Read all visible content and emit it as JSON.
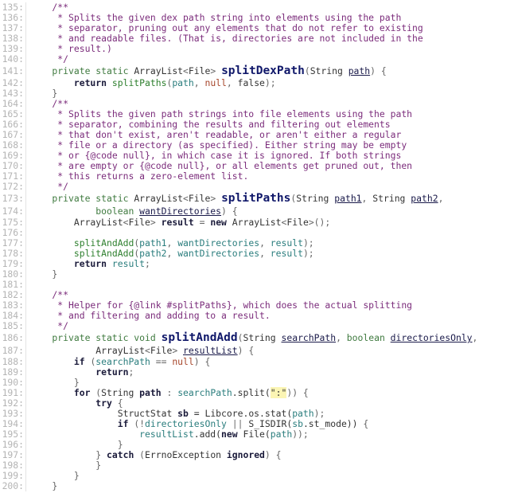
{
  "editor": {
    "colors": {
      "comment": "#7b2c7b",
      "keyword": "#3f7a3f",
      "method_decl": "#10186a",
      "call": "#2d7f2d",
      "variable": "#2a7d7d",
      "null": "#a6452a",
      "string_bg": "#fbf5b4"
    },
    "lines": [
      {
        "num": "135:",
        "tokens": [
          [
            "c",
            "    /**"
          ]
        ]
      },
      {
        "num": "136:",
        "tokens": [
          [
            "c",
            "     * Splits the given dex path string into elements using the path"
          ]
        ]
      },
      {
        "num": "137:",
        "tokens": [
          [
            "c",
            "     * separator, pruning out any elements that do not refer to existing"
          ]
        ]
      },
      {
        "num": "138:",
        "tokens": [
          [
            "c",
            "     * and readable files. (That is, directories are not included in the"
          ]
        ]
      },
      {
        "num": "139:",
        "tokens": [
          [
            "c",
            "     * result.)"
          ]
        ]
      },
      {
        "num": "140:",
        "tokens": [
          [
            "c",
            "     */"
          ]
        ]
      },
      {
        "num": "141:",
        "kind": "sig",
        "tokens": [
          [
            "k",
            "    private static "
          ],
          [
            "t",
            "ArrayList"
          ],
          [
            "p",
            "<"
          ],
          [
            "t",
            "File"
          ],
          [
            "p",
            "> "
          ],
          [
            "m",
            "splitDexPath"
          ],
          [
            "p",
            "("
          ],
          [
            "t",
            "String "
          ],
          [
            "u",
            "path"
          ],
          [
            "p",
            ") {"
          ]
        ]
      },
      {
        "num": "142:",
        "tokens": [
          [
            "kb",
            "        return "
          ],
          [
            "f",
            "splitPaths"
          ],
          [
            "p",
            "("
          ],
          [
            "v",
            "path"
          ],
          [
            "p",
            ", "
          ],
          [
            "n",
            "null"
          ],
          [
            "p",
            ", "
          ],
          [
            "t",
            "false"
          ],
          [
            "p",
            ");"
          ]
        ]
      },
      {
        "num": "143:",
        "tokens": [
          [
            "p",
            "    }"
          ]
        ]
      },
      {
        "num": "164:",
        "tokens": [
          [
            "c",
            "    /**"
          ]
        ]
      },
      {
        "num": "165:",
        "tokens": [
          [
            "c",
            "     * Splits the given path strings into file elements using the path"
          ]
        ]
      },
      {
        "num": "166:",
        "tokens": [
          [
            "c",
            "     * separator, combining the results and filtering out elements"
          ]
        ]
      },
      {
        "num": "167:",
        "tokens": [
          [
            "c",
            "     * that don't exist, aren't readable, or aren't either a regular"
          ]
        ]
      },
      {
        "num": "168:",
        "tokens": [
          [
            "c",
            "     * file or a directory (as specified). Either string may be empty"
          ]
        ]
      },
      {
        "num": "169:",
        "tokens": [
          [
            "c",
            "     * or {@code null}, in which case it is ignored. If both strings"
          ]
        ]
      },
      {
        "num": "170:",
        "tokens": [
          [
            "c",
            "     * are empty or {@code null}, or all elements get pruned out, then"
          ]
        ]
      },
      {
        "num": "171:",
        "tokens": [
          [
            "c",
            "     * this returns a zero-element list."
          ]
        ]
      },
      {
        "num": "172:",
        "tokens": [
          [
            "c",
            "     */"
          ]
        ]
      },
      {
        "num": "173:",
        "kind": "sig",
        "tokens": [
          [
            "k",
            "    private static "
          ],
          [
            "t",
            "ArrayList"
          ],
          [
            "p",
            "<"
          ],
          [
            "t",
            "File"
          ],
          [
            "p",
            "> "
          ],
          [
            "m",
            "splitPaths"
          ],
          [
            "p",
            "("
          ],
          [
            "t",
            "String "
          ],
          [
            "u",
            "path1"
          ],
          [
            "p",
            ", "
          ],
          [
            "t",
            "String "
          ],
          [
            "u",
            "path2"
          ],
          [
            "p",
            ","
          ]
        ]
      },
      {
        "num": "174:",
        "kind": "sig2",
        "tokens": [
          [
            "k",
            "            boolean "
          ],
          [
            "u",
            "wantDirectories"
          ],
          [
            "p",
            ") {"
          ]
        ]
      },
      {
        "num": "175:",
        "tokens": [
          [
            "t",
            "        ArrayList"
          ],
          [
            "p",
            "<"
          ],
          [
            "t",
            "File"
          ],
          [
            "p",
            "> "
          ],
          [
            "lv",
            "result"
          ],
          [
            "p",
            " = "
          ],
          [
            "kb",
            "new "
          ],
          [
            "t",
            "ArrayList"
          ],
          [
            "p",
            "<"
          ],
          [
            "t",
            "File"
          ],
          [
            "p",
            ">();"
          ]
        ]
      },
      {
        "num": "176:",
        "tokens": []
      },
      {
        "num": "177:",
        "tokens": [
          [
            "f",
            "        splitAndAdd"
          ],
          [
            "p",
            "("
          ],
          [
            "v",
            "path1"
          ],
          [
            "p",
            ", "
          ],
          [
            "v",
            "wantDirectories"
          ],
          [
            "p",
            ", "
          ],
          [
            "v",
            "result"
          ],
          [
            "p",
            ");"
          ]
        ]
      },
      {
        "num": "178:",
        "tokens": [
          [
            "f",
            "        splitAndAdd"
          ],
          [
            "p",
            "("
          ],
          [
            "v",
            "path2"
          ],
          [
            "p",
            ", "
          ],
          [
            "v",
            "wantDirectories"
          ],
          [
            "p",
            ", "
          ],
          [
            "v",
            "result"
          ],
          [
            "p",
            ");"
          ]
        ]
      },
      {
        "num": "179:",
        "tokens": [
          [
            "kb",
            "        return "
          ],
          [
            "v",
            "result"
          ],
          [
            "p",
            ";"
          ]
        ]
      },
      {
        "num": "180:",
        "tokens": [
          [
            "p",
            "    }"
          ]
        ]
      },
      {
        "num": "181:",
        "tokens": []
      },
      {
        "num": "182:",
        "tokens": [
          [
            "c",
            "    /**"
          ]
        ]
      },
      {
        "num": "183:",
        "tokens": [
          [
            "c",
            "     * Helper for {@link #splitPaths}, which does the actual splitting"
          ]
        ]
      },
      {
        "num": "184:",
        "tokens": [
          [
            "c",
            "     * and filtering and adding to a result."
          ]
        ]
      },
      {
        "num": "185:",
        "tokens": [
          [
            "c",
            "     */"
          ]
        ]
      },
      {
        "num": "186:",
        "kind": "sig",
        "tokens": [
          [
            "k",
            "    private static void "
          ],
          [
            "m",
            "splitAndAdd"
          ],
          [
            "p",
            "("
          ],
          [
            "t",
            "String "
          ],
          [
            "u",
            "searchPath"
          ],
          [
            "p",
            ", "
          ],
          [
            "k",
            "boolean "
          ],
          [
            "u",
            "directoriesOnly"
          ],
          [
            "p",
            ","
          ]
        ]
      },
      {
        "num": "187:",
        "kind": "sig2",
        "tokens": [
          [
            "t",
            "            ArrayList"
          ],
          [
            "p",
            "<"
          ],
          [
            "t",
            "File"
          ],
          [
            "p",
            "> "
          ],
          [
            "u",
            "resultList"
          ],
          [
            "p",
            ") {"
          ]
        ]
      },
      {
        "num": "188:",
        "tokens": [
          [
            "kb",
            "        if "
          ],
          [
            "p",
            "("
          ],
          [
            "v",
            "searchPath"
          ],
          [
            "p",
            " == "
          ],
          [
            "n",
            "null"
          ],
          [
            "p",
            ") {"
          ]
        ]
      },
      {
        "num": "189:",
        "tokens": [
          [
            "kb",
            "            return"
          ],
          [
            "p",
            ";"
          ]
        ]
      },
      {
        "num": "190:",
        "tokens": [
          [
            "p",
            "        }"
          ]
        ]
      },
      {
        "num": "191:",
        "tokens": [
          [
            "kb",
            "        for "
          ],
          [
            "p",
            "("
          ],
          [
            "t",
            "String "
          ],
          [
            "lv",
            "path"
          ],
          [
            "p",
            " : "
          ],
          [
            "v",
            "searchPath"
          ],
          [
            "t",
            ".split("
          ],
          [
            "s",
            "\":\""
          ],
          [
            "p",
            ")) {"
          ]
        ]
      },
      {
        "num": "192:",
        "tokens": [
          [
            "kb",
            "            try "
          ],
          [
            "p",
            "{"
          ]
        ]
      },
      {
        "num": "193:",
        "tokens": [
          [
            "t",
            "                StructStat "
          ],
          [
            "lv",
            "sb"
          ],
          [
            "t",
            " = Libcore.os.stat("
          ],
          [
            "v",
            "path"
          ],
          [
            "p",
            ");"
          ]
        ]
      },
      {
        "num": "194:",
        "tokens": [
          [
            "kb",
            "                if "
          ],
          [
            "p",
            "(!"
          ],
          [
            "v",
            "directoriesOnly"
          ],
          [
            "p",
            " || "
          ],
          [
            "t",
            "S_ISDIR("
          ],
          [
            "v",
            "sb"
          ],
          [
            "t",
            ".st_mode)) "
          ],
          [
            "p",
            "{"
          ]
        ]
      },
      {
        "num": "195:",
        "tokens": [
          [
            "v",
            "                    resultList"
          ],
          [
            "t",
            ".add("
          ],
          [
            "kb",
            "new "
          ],
          [
            "t",
            "File("
          ],
          [
            "v",
            "path"
          ],
          [
            "p",
            "));"
          ]
        ]
      },
      {
        "num": "196:",
        "tokens": [
          [
            "p",
            "                }"
          ]
        ]
      },
      {
        "num": "197:",
        "tokens": [
          [
            "p",
            "            } "
          ],
          [
            "kb",
            "catch "
          ],
          [
            "p",
            "("
          ],
          [
            "t",
            "ErrnoException "
          ],
          [
            "lv",
            "ignored"
          ],
          [
            "p",
            ") {"
          ]
        ]
      },
      {
        "num": "198:",
        "tokens": [
          [
            "p",
            "            }"
          ]
        ]
      },
      {
        "num": "199:",
        "tokens": [
          [
            "p",
            "        }"
          ]
        ]
      },
      {
        "num": "200:",
        "tokens": [
          [
            "p",
            "    }"
          ]
        ]
      }
    ]
  }
}
